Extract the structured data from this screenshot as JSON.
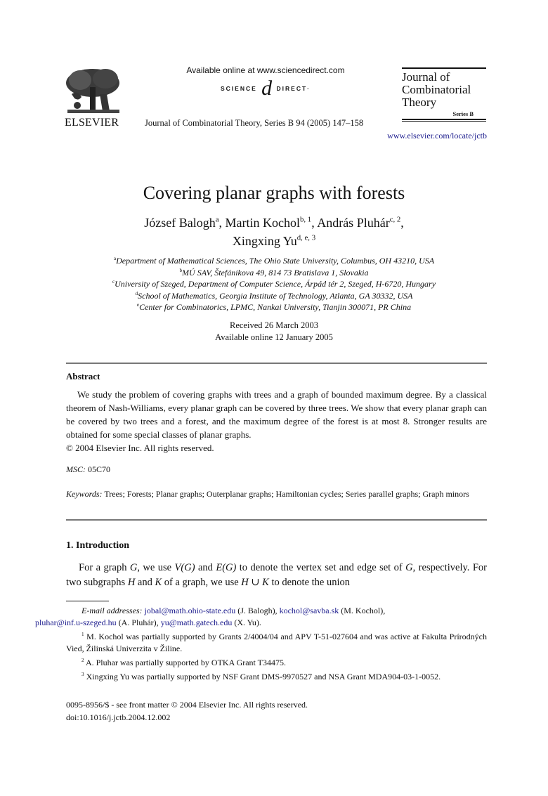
{
  "header": {
    "publisher": "ELSEVIER",
    "sd_available": "Available online at www.sciencedirect.com",
    "sd_logo_left": "SCIENCE",
    "sd_logo_at": "d",
    "sd_logo_right": "DIRECT·",
    "journal_citation": "Journal of Combinatorial Theory, Series B 94 (2005) 147–158",
    "journal_logo_lines": [
      "Journal of",
      "Combinatorial",
      "Theory"
    ],
    "journal_logo_series": "Series B",
    "journal_url": "www.elsevier.com/locate/jctb"
  },
  "title": "Covering planar graphs with forests",
  "authors": [
    {
      "name": "József Balogh",
      "sup": "a",
      "sep": ", "
    },
    {
      "name": "Martin Kochol",
      "sup": "b, 1",
      "sep": ", "
    },
    {
      "name": "András Pluhár",
      "sup": "c, 2",
      "sep": ","
    },
    {
      "name": "Xingxing Yu",
      "sup": "d, e, 3",
      "sep": ""
    }
  ],
  "affiliations": [
    {
      "key": "a",
      "text": "Department of Mathematical Sciences, The Ohio State University, Columbus, OH 43210, USA"
    },
    {
      "key": "b",
      "text": "MÚ SAV, Štefánikova 49, 814 73 Bratislava 1, Slovakia"
    },
    {
      "key": "c",
      "text": "University of Szeged, Department of Computer Science, Árpád tér 2, Szeged, H-6720, Hungary"
    },
    {
      "key": "d",
      "text": "School of Mathematics, Georgia Institute of Technology, Atlanta, GA 30332, USA"
    },
    {
      "key": "e",
      "text": "Center for Combinatorics, LPMC, Nankai University, Tianjin 300071, PR China"
    }
  ],
  "dates": {
    "received": "Received 26 March 2003",
    "online": "Available online 12 January 2005"
  },
  "abstract": {
    "heading": "Abstract",
    "text": "We study the problem of covering graphs with trees and a graph of bounded maximum degree. By a classical theorem of Nash-Williams, every planar graph can be covered by three trees. We show that every planar graph can be covered by two trees and a forest, and the maximum degree of the forest is at most 8. Stronger results are obtained for some special classes of planar graphs.",
    "copyright": "© 2004 Elsevier Inc. All rights reserved."
  },
  "msc": {
    "label": "MSC:",
    "value": "05C70"
  },
  "keywords": {
    "label": "Keywords:",
    "value": "Trees; Forests; Planar graphs; Outerplanar graphs; Hamiltonian cycles; Series parallel graphs; Graph minors"
  },
  "introduction": {
    "heading": "1.  Introduction",
    "p1_a": "For a graph ",
    "G": "G",
    "p1_b": ", we use ",
    "VG": "V(G)",
    "p1_c": " and ",
    "EG": "E(G)",
    "p1_d": " to denote the vertex set and edge set of ",
    "p1_e": ", respectively. For two subgraphs ",
    "H": "H",
    "p1_f": " and ",
    "K": "K",
    "p1_g": " of a graph, we use ",
    "HuK": "H ∪ K",
    "p1_h": " to denote the union"
  },
  "footnotes": {
    "email_label": "E-mail addresses:",
    "emails": [
      {
        "addr": "jobal@math.ohio-state.edu",
        "who": " (J. Balogh), "
      },
      {
        "addr": "kochol@savba.sk",
        "who": " (M. Kochol), "
      },
      {
        "addr": "pluhar@inf.u-szeged.hu",
        "who": " (A. Pluhár), "
      },
      {
        "addr": "yu@math.gatech.edu",
        "who": " (X. Yu)."
      }
    ],
    "notes": [
      {
        "num": "1",
        "text": "M. Kochol was partially supported by Grants 2/4004/04 and APV T-51-027604 and was active at Fakulta Prírodných Vied, Žilinská Univerzita v Žiline."
      },
      {
        "num": "2",
        "text": "A. Pluhar was partially supported by OTKA Grant T34475."
      },
      {
        "num": "3",
        "text": "Xingxing Yu was partially supported by NSF Grant DMS-9970527 and NSA Grant MDA904-03-1-0052."
      }
    ]
  },
  "footer": {
    "issn": "0095-8956/$ - see front matter © 2004 Elsevier Inc. All rights reserved.",
    "doi": "doi:10.1016/j.jctb.2004.12.002"
  },
  "colors": {
    "link": "#1a1a8c",
    "rule": "#777777",
    "text": "#111111"
  }
}
